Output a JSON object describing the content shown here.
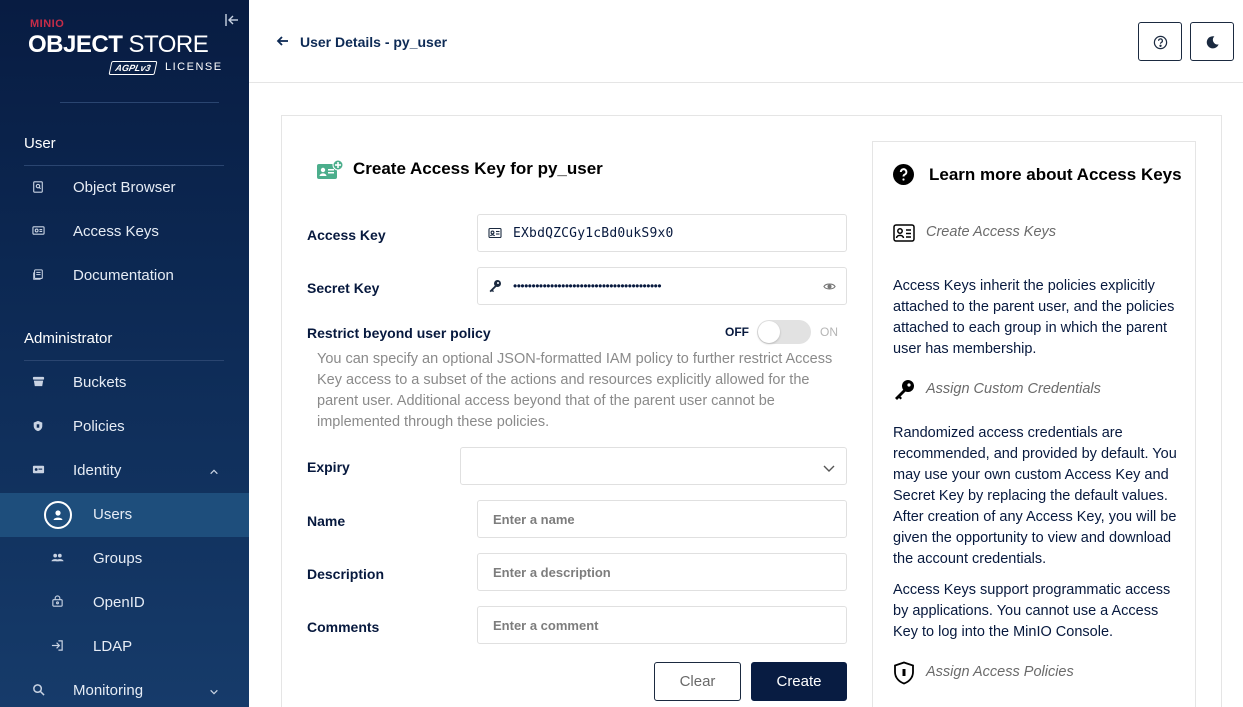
{
  "brand": {
    "prefix": "MINIO",
    "title_bold": "OBJECT",
    "title_rest": " STORE",
    "badge": "AGPLv3",
    "license": "LICENSE"
  },
  "sidebar": {
    "user_section": "User",
    "user_items": [
      {
        "label": "Object Browser",
        "icon": "object-browser-icon"
      },
      {
        "label": "Access Keys",
        "icon": "access-keys-icon"
      },
      {
        "label": "Documentation",
        "icon": "documentation-icon"
      }
    ],
    "admin_section": "Administrator",
    "admin_items": [
      {
        "label": "Buckets",
        "icon": "buckets-icon"
      },
      {
        "label": "Policies",
        "icon": "policies-icon"
      },
      {
        "label": "Identity",
        "icon": "identity-icon"
      },
      {
        "label": "Users",
        "icon": "users-icon"
      },
      {
        "label": "Groups",
        "icon": "groups-icon"
      },
      {
        "label": "OpenID",
        "icon": "openid-icon"
      },
      {
        "label": "LDAP",
        "icon": "ldap-icon"
      },
      {
        "label": "Monitoring",
        "icon": "monitoring-icon"
      }
    ]
  },
  "header": {
    "title": "User Details - py_user"
  },
  "form": {
    "title": "Create Access Key for py_user",
    "access_key_label": "Access Key",
    "access_key_value": "EXbdQZCGy1cBd0ukS9x0",
    "secret_key_label": "Secret Key",
    "secret_key_value": "••••••••••••••••••••••••••••••••••••••••",
    "restrict_label": "Restrict beyond user policy",
    "toggle_off": "OFF",
    "toggle_on": "ON",
    "restrict_state": false,
    "restrict_desc": "You can specify an optional JSON-formatted IAM policy to further restrict Access Key access to a subset of the actions and resources explicitly allowed for the parent user. Additional access beyond that of the parent user cannot be implemented through these policies.",
    "expiry_label": "Expiry",
    "expiry_value": "",
    "name_label": "Name",
    "name_placeholder": "Enter a name",
    "description_label": "Description",
    "description_placeholder": "Enter a description",
    "comments_label": "Comments",
    "comments_placeholder": "Enter a comment",
    "clear_button": "Clear",
    "create_button": "Create"
  },
  "help": {
    "title": "Learn more about Access Keys",
    "sub1": "Create Access Keys",
    "para1": "Access Keys inherit the policies explicitly attached to the parent user, and the policies attached to each group in which the parent user has membership.",
    "sub2": "Assign Custom Credentials",
    "para2": "Randomized access credentials are recommended, and provided by default. You may use your own custom Access Key and Secret Key by replacing the default values. After creation of any Access Key, you will be given the opportunity to view and download the account credentials.",
    "para3": "Access Keys support programmatic access by applications. You cannot use a Access Key to log into the MinIO Console.",
    "sub3": "Assign Access Policies"
  },
  "colors": {
    "sidebar": "#0d2a55",
    "active_item": "#1e4e7c",
    "primary_button": "#081c42",
    "brand_red": "#c72c48"
  }
}
